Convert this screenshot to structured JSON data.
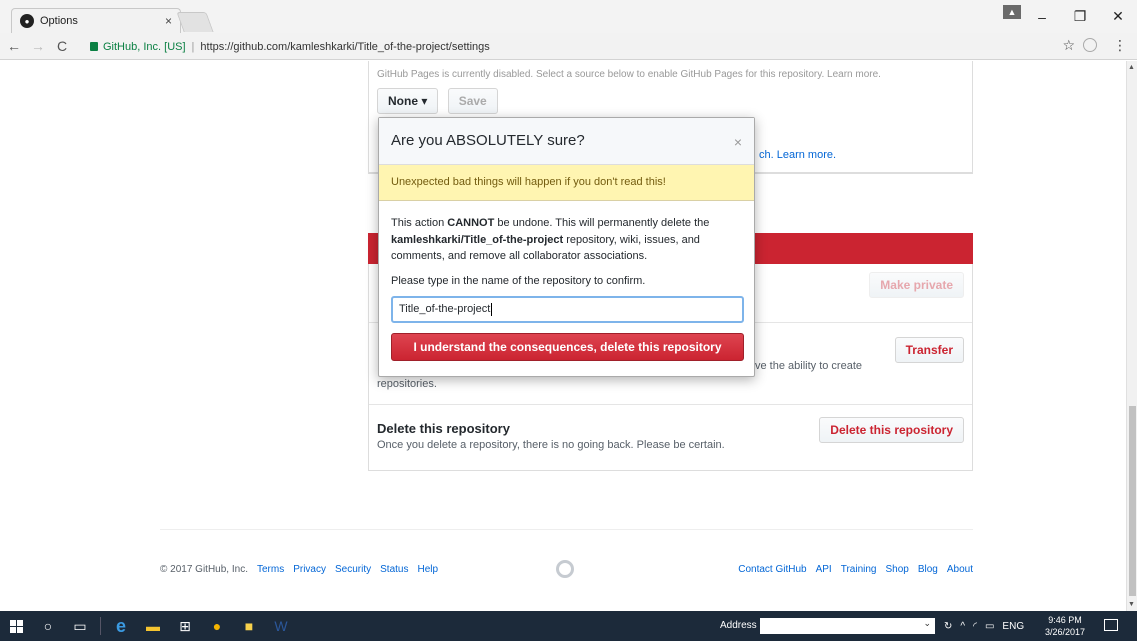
{
  "browser": {
    "tab_title": "Options",
    "tab_close": "×",
    "secure_label": "GitHub, Inc. [US]",
    "url": "https://github.com/kamleshkarki/Title_of-the-project/settings"
  },
  "pages_section": {
    "faded_text": "GitHub Pages is currently disabled. Select a source below to enable GitHub Pages for this repository. Learn more.",
    "source_dropdown": "None ▾",
    "save_label": "Save",
    "learn_more_tail": "ch. Learn more."
  },
  "danger_zone": {
    "make_private_label": "Make private",
    "transfer_label": "Transfer",
    "transfer_desc_tail": "ve the ability to create",
    "transfer_desc_wrap": "repositories.",
    "delete_title": "Delete this repository",
    "delete_desc": "Once you delete a repository, there is no going back. Please be certain.",
    "delete_button": "Delete this repository"
  },
  "modal": {
    "title": "Are you ABSOLUTELY sure?",
    "close": "×",
    "warning": "Unexpected bad things will happen if you don't read this!",
    "body_1": "This action ",
    "body_cannot": "CANNOT",
    "body_2": " be undone. This will permanently delete the ",
    "body_repo": "kamleshkarki/Title_of-the-project",
    "body_3": " repository, wiki, issues, and comments, and remove all collaborator associations.",
    "confirm_label": "Please type in the name of the repository to confirm.",
    "input_value": "Title_of-the-project",
    "confirm_button": "I understand the consequences, delete this repository"
  },
  "footer": {
    "copyright": "© 2017 GitHub, Inc.",
    "left_links": [
      "Terms",
      "Privacy",
      "Security",
      "Status",
      "Help"
    ],
    "right_links": [
      "Contact GitHub",
      "API",
      "Training",
      "Shop",
      "Blog",
      "About"
    ]
  },
  "taskbar": {
    "address_label": "Address",
    "language": "ENG",
    "time": "9:46 PM",
    "date": "3/26/2017"
  }
}
